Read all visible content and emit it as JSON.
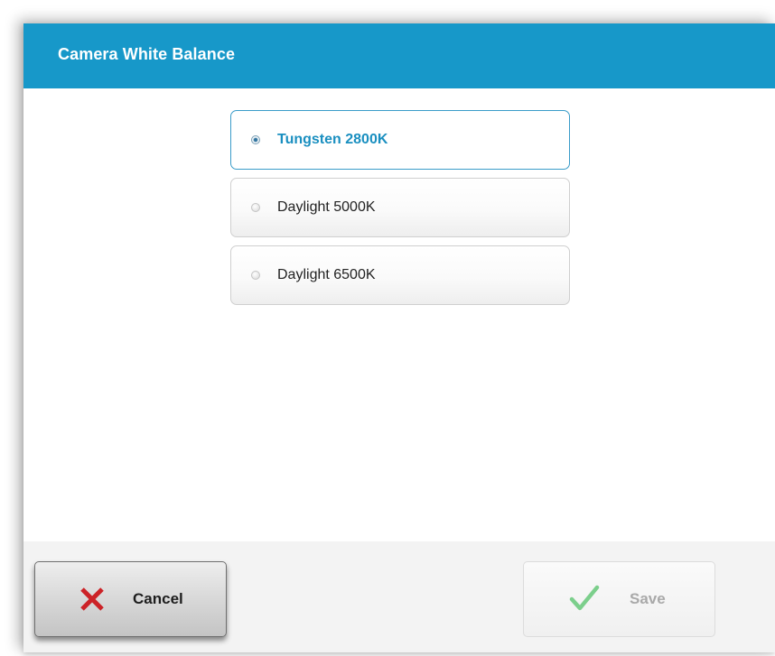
{
  "dialog": {
    "title": "Camera White Balance"
  },
  "options": [
    {
      "label": "Tungsten 2800K",
      "selected": true
    },
    {
      "label": "Daylight 5000K",
      "selected": false
    },
    {
      "label": "Daylight 6500K",
      "selected": false
    }
  ],
  "footer": {
    "cancel_label": "Cancel",
    "cancel_icon": "x-icon",
    "save_label": "Save",
    "save_icon": "checkmark-icon",
    "save_enabled": false
  },
  "colors": {
    "titlebar": "#1798c9",
    "selected_text": "#1a8fc0",
    "cancel_icon": "#cc2227",
    "save_icon": "#7ccf8c"
  }
}
